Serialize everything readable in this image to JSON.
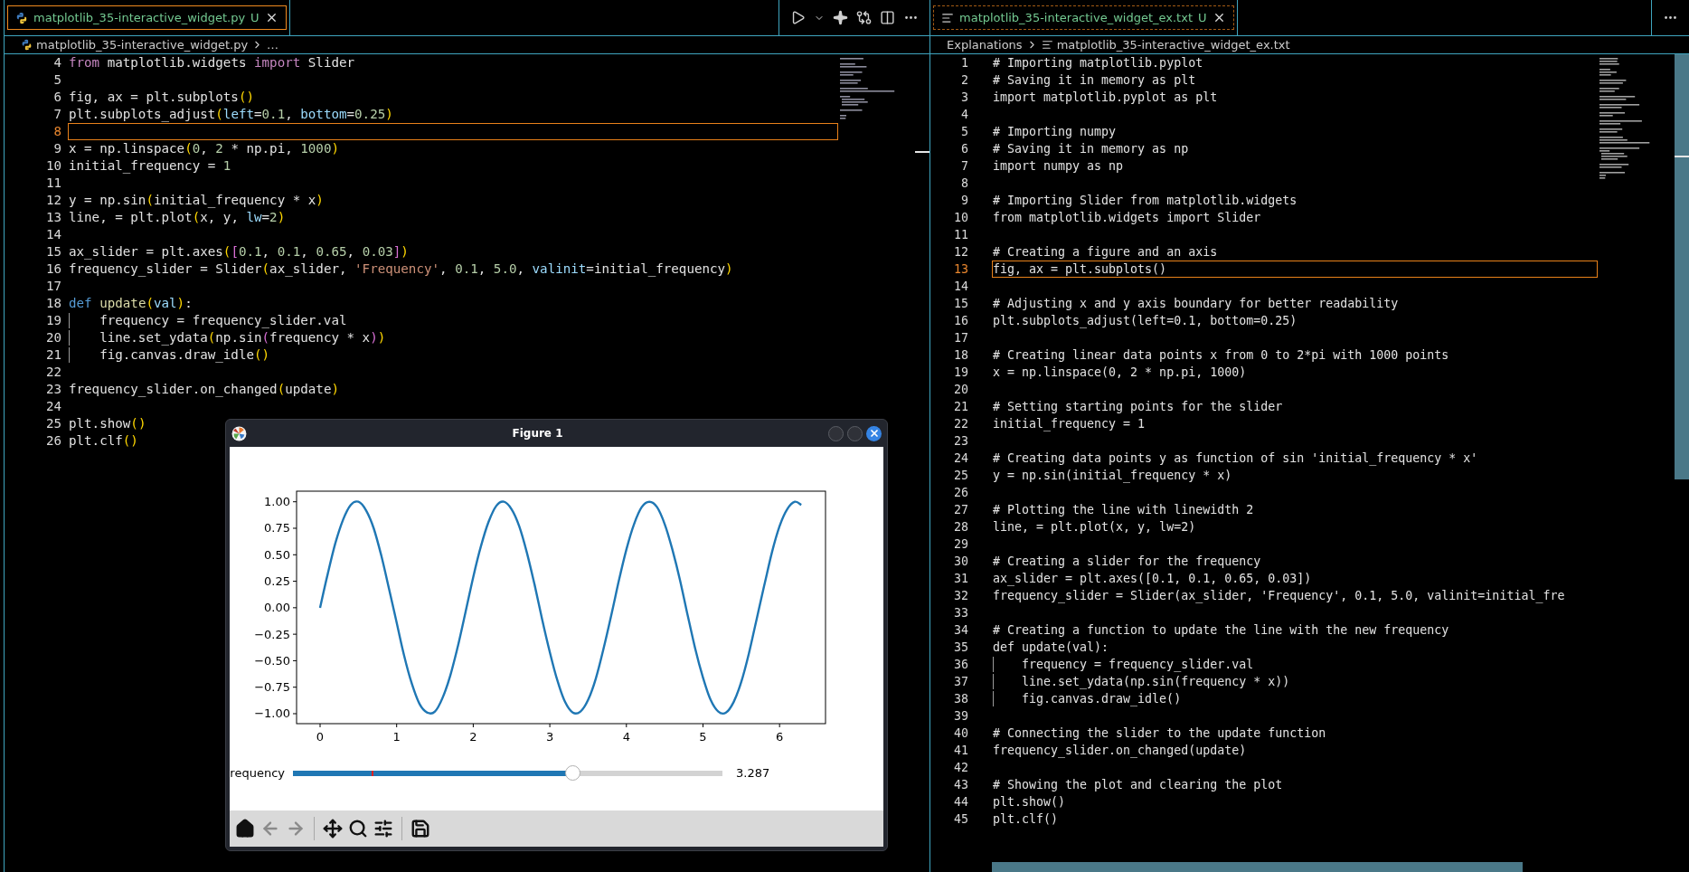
{
  "panes": [
    {
      "tab": {
        "kind": "python",
        "label": "matplotlib_35-interactive_widget.py",
        "status": "U",
        "focused": true
      },
      "actions": [
        {
          "kind": "run"
        },
        {
          "kind": "dropdown"
        },
        {
          "kind": "sparkle"
        },
        {
          "kind": "compare"
        },
        {
          "kind": "split"
        },
        {
          "kind": "more"
        }
      ],
      "breadcrumb": [
        {
          "kind": "python",
          "label": "matplotlib_35-interactive_widget.py"
        },
        {
          "kind": "plain",
          "label": "…"
        }
      ],
      "scrollable": false,
      "lines": [
        {
          "number": "4",
          "current": false,
          "tokens": [
            {
              "kind": "keyword",
              "text": "from"
            },
            {
              "kind": "text",
              "text": " matplotlib.widgets "
            },
            {
              "kind": "keyword",
              "text": "import"
            },
            {
              "kind": "text",
              "text": " Slider"
            }
          ]
        },
        {
          "number": "5",
          "current": false
        },
        {
          "number": "6",
          "current": false,
          "tokens": [
            {
              "kind": "text",
              "text": "fig, ax = plt.subplots"
            },
            {
              "kind": "bracket",
              "text": "()"
            }
          ]
        },
        {
          "number": "7",
          "current": false,
          "tokens": [
            {
              "kind": "text",
              "text": "plt.subplots_adjust"
            },
            {
              "kind": "bracket",
              "text": "("
            },
            {
              "kind": "param",
              "text": "left"
            },
            {
              "kind": "text",
              "text": "="
            },
            {
              "kind": "number",
              "text": "0.1"
            },
            {
              "kind": "text",
              "text": ", "
            },
            {
              "kind": "param",
              "text": "bottom"
            },
            {
              "kind": "text",
              "text": "="
            },
            {
              "kind": "number",
              "text": "0.25"
            },
            {
              "kind": "bracket",
              "text": ")"
            }
          ]
        },
        {
          "number": "8",
          "current": true
        },
        {
          "number": "9",
          "current": false,
          "tokens": [
            {
              "kind": "text",
              "text": "x = np.linspace"
            },
            {
              "kind": "bracket",
              "text": "("
            },
            {
              "kind": "number",
              "text": "0"
            },
            {
              "kind": "text",
              "text": ", "
            },
            {
              "kind": "number",
              "text": "2"
            },
            {
              "kind": "text",
              "text": " * np.pi, "
            },
            {
              "kind": "number",
              "text": "1000"
            },
            {
              "kind": "bracket",
              "text": ")"
            }
          ]
        },
        {
          "number": "10",
          "current": false,
          "tokens": [
            {
              "kind": "text",
              "text": "initial_frequency = "
            },
            {
              "kind": "number",
              "text": "1"
            }
          ]
        },
        {
          "number": "11",
          "current": false
        },
        {
          "number": "12",
          "current": false,
          "tokens": [
            {
              "kind": "text",
              "text": "y = np.sin"
            },
            {
              "kind": "bracket",
              "text": "("
            },
            {
              "kind": "text",
              "text": "initial_frequency * x"
            },
            {
              "kind": "bracket",
              "text": ")"
            }
          ]
        },
        {
          "number": "13",
          "current": false,
          "tokens": [
            {
              "kind": "text",
              "text": "line, = plt.plot"
            },
            {
              "kind": "bracket",
              "text": "("
            },
            {
              "kind": "text",
              "text": "x, y, "
            },
            {
              "kind": "param",
              "text": "lw"
            },
            {
              "kind": "text",
              "text": "="
            },
            {
              "kind": "number",
              "text": "2"
            },
            {
              "kind": "bracket",
              "text": ")"
            }
          ]
        },
        {
          "number": "14",
          "current": false
        },
        {
          "number": "15",
          "current": false,
          "tokens": [
            {
              "kind": "text",
              "text": "ax_slider = plt.axes"
            },
            {
              "kind": "bracket",
              "text": "("
            },
            {
              "kind": "bracket2",
              "text": "["
            },
            {
              "kind": "number",
              "text": "0.1"
            },
            {
              "kind": "text",
              "text": ", "
            },
            {
              "kind": "number",
              "text": "0.1"
            },
            {
              "kind": "text",
              "text": ", "
            },
            {
              "kind": "number",
              "text": "0.65"
            },
            {
              "kind": "text",
              "text": ", "
            },
            {
              "kind": "number",
              "text": "0.03"
            },
            {
              "kind": "bracket2",
              "text": "]"
            },
            {
              "kind": "bracket",
              "text": ")"
            }
          ]
        },
        {
          "number": "16",
          "current": false,
          "tokens": [
            {
              "kind": "text",
              "text": "frequency_slider = Slider"
            },
            {
              "kind": "bracket",
              "text": "("
            },
            {
              "kind": "text",
              "text": "ax_slider, "
            },
            {
              "kind": "string",
              "text": "'Frequency'"
            },
            {
              "kind": "text",
              "text": ", "
            },
            {
              "kind": "number",
              "text": "0.1"
            },
            {
              "kind": "text",
              "text": ", "
            },
            {
              "kind": "number",
              "text": "5.0"
            },
            {
              "kind": "text",
              "text": ", "
            },
            {
              "kind": "param",
              "text": "valinit"
            },
            {
              "kind": "text",
              "text": "=initial_frequency"
            },
            {
              "kind": "bracket",
              "text": ")"
            }
          ]
        },
        {
          "number": "17",
          "current": false
        },
        {
          "number": "18",
          "current": false,
          "tokens": [
            {
              "kind": "storage",
              "text": "def "
            },
            {
              "kind": "function",
              "text": "update"
            },
            {
              "kind": "bracket",
              "text": "("
            },
            {
              "kind": "param",
              "text": "val"
            },
            {
              "kind": "bracket",
              "text": ")"
            },
            {
              "kind": "text",
              "text": ":"
            }
          ]
        },
        {
          "number": "19",
          "current": false,
          "indent": true,
          "tokens": [
            {
              "kind": "text",
              "text": "frequency = frequency_slider.val"
            }
          ]
        },
        {
          "number": "20",
          "current": false,
          "indent": true,
          "tokens": [
            {
              "kind": "text",
              "text": "line.set_ydata"
            },
            {
              "kind": "bracket",
              "text": "("
            },
            {
              "kind": "text",
              "text": "np.sin"
            },
            {
              "kind": "bracket2",
              "text": "("
            },
            {
              "kind": "text",
              "text": "frequency * x"
            },
            {
              "kind": "bracket2",
              "text": ")"
            },
            {
              "kind": "bracket",
              "text": ")"
            }
          ]
        },
        {
          "number": "21",
          "current": false,
          "indent": true,
          "tokens": [
            {
              "kind": "text",
              "text": "fig.canvas.draw_idle"
            },
            {
              "kind": "bracket",
              "text": "()"
            }
          ]
        },
        {
          "number": "22",
          "current": false
        },
        {
          "number": "23",
          "current": false,
          "tokens": [
            {
              "kind": "text",
              "text": "frequency_slider.on_changed"
            },
            {
              "kind": "bracket",
              "text": "("
            },
            {
              "kind": "text",
              "text": "update"
            },
            {
              "kind": "bracket",
              "text": ")"
            }
          ]
        },
        {
          "number": "24",
          "current": false
        },
        {
          "number": "25",
          "current": false,
          "tokens": [
            {
              "kind": "text",
              "text": "plt.show"
            },
            {
              "kind": "bracket",
              "text": "()"
            }
          ]
        },
        {
          "number": "26",
          "current": false,
          "tokens": [
            {
              "kind": "text",
              "text": "plt.clf"
            },
            {
              "kind": "bracket",
              "text": "()"
            }
          ]
        }
      ]
    },
    {
      "tab": {
        "kind": "text",
        "label": "matplotlib_35-interactive_widget_ex.txt",
        "status": "U",
        "focused": false
      },
      "actions": [
        {
          "kind": "more"
        }
      ],
      "breadcrumb": [
        {
          "kind": "plain",
          "label": "Explanations"
        },
        {
          "kind": "text",
          "label": "matplotlib_35-interactive_widget_ex.txt"
        }
      ],
      "scrollable": true,
      "lines": [
        {
          "number": "1",
          "current": false,
          "tokens": [
            {
              "kind": "text",
              "text": "# Importing matplotlib.pyplot"
            }
          ]
        },
        {
          "number": "2",
          "current": false,
          "tokens": [
            {
              "kind": "text",
              "text": "# Saving it in memory as plt"
            }
          ]
        },
        {
          "number": "3",
          "current": false,
          "tokens": [
            {
              "kind": "text",
              "text": "import matplotlib.pyplot as plt"
            }
          ]
        },
        {
          "number": "4",
          "current": false
        },
        {
          "number": "5",
          "current": false,
          "tokens": [
            {
              "kind": "text",
              "text": "# Importing numpy"
            }
          ]
        },
        {
          "number": "6",
          "current": false,
          "tokens": [
            {
              "kind": "text",
              "text": "# Saving it in memory as np"
            }
          ]
        },
        {
          "number": "7",
          "current": false,
          "tokens": [
            {
              "kind": "text",
              "text": "import numpy as np"
            }
          ]
        },
        {
          "number": "8",
          "current": false
        },
        {
          "number": "9",
          "current": false,
          "tokens": [
            {
              "kind": "text",
              "text": "# Importing Slider from matplotlib.widgets"
            }
          ]
        },
        {
          "number": "10",
          "current": false,
          "tokens": [
            {
              "kind": "text",
              "text": "from matplotlib.widgets import Slider"
            }
          ]
        },
        {
          "number": "11",
          "current": false
        },
        {
          "number": "12",
          "current": false,
          "tokens": [
            {
              "kind": "text",
              "text": "# Creating a figure and an axis"
            }
          ]
        },
        {
          "number": "13",
          "current": true,
          "tokens": [
            {
              "kind": "text",
              "text": "fig, ax = plt.subplots()"
            }
          ]
        },
        {
          "number": "14",
          "current": false
        },
        {
          "number": "15",
          "current": false,
          "tokens": [
            {
              "kind": "text",
              "text": "# Adjusting x and y axis boundary for better readability"
            }
          ]
        },
        {
          "number": "16",
          "current": false,
          "tokens": [
            {
              "kind": "text",
              "text": "plt.subplots_adjust(left=0.1, bottom=0.25)"
            }
          ]
        },
        {
          "number": "17",
          "current": false
        },
        {
          "number": "18",
          "current": false,
          "tokens": [
            {
              "kind": "text",
              "text": "# Creating linear data points x from 0 to 2*pi with 1000 points"
            }
          ]
        },
        {
          "number": "19",
          "current": false,
          "tokens": [
            {
              "kind": "text",
              "text": "x = np.linspace(0, 2 * np.pi, 1000)"
            }
          ]
        },
        {
          "number": "20",
          "current": false
        },
        {
          "number": "21",
          "current": false,
          "tokens": [
            {
              "kind": "text",
              "text": "# Setting starting points for the slider"
            }
          ]
        },
        {
          "number": "22",
          "current": false,
          "tokens": [
            {
              "kind": "text",
              "text": "initial_frequency = 1"
            }
          ]
        },
        {
          "number": "23",
          "current": false
        },
        {
          "number": "24",
          "current": false,
          "tokens": [
            {
              "kind": "text",
              "text": "# Creating data points y as function of sin 'initial_frequency * x'"
            }
          ]
        },
        {
          "number": "25",
          "current": false,
          "tokens": [
            {
              "kind": "text",
              "text": "y = np.sin(initial_frequency * x)"
            }
          ]
        },
        {
          "number": "26",
          "current": false
        },
        {
          "number": "27",
          "current": false,
          "tokens": [
            {
              "kind": "text",
              "text": "# Plotting the line with linewidth 2"
            }
          ]
        },
        {
          "number": "28",
          "current": false,
          "tokens": [
            {
              "kind": "text",
              "text": "line, = plt.plot(x, y, lw=2)"
            }
          ]
        },
        {
          "number": "29",
          "current": false
        },
        {
          "number": "30",
          "current": false,
          "tokens": [
            {
              "kind": "text",
              "text": "# Creating a slider for the frequency"
            }
          ]
        },
        {
          "number": "31",
          "current": false,
          "tokens": [
            {
              "kind": "text",
              "text": "ax_slider = plt.axes([0.1, 0.1, 0.65, 0.03])"
            }
          ]
        },
        {
          "number": "32",
          "current": false,
          "tokens": [
            {
              "kind": "text",
              "text": "frequency_slider = Slider(ax_slider, 'Frequency', 0.1, 5.0, valinit=initial_fre"
            }
          ]
        },
        {
          "number": "33",
          "current": false
        },
        {
          "number": "34",
          "current": false,
          "tokens": [
            {
              "kind": "text",
              "text": "# Creating a function to update the line with the new frequency"
            }
          ]
        },
        {
          "number": "35",
          "current": false,
          "tokens": [
            {
              "kind": "text",
              "text": "def update(val):"
            }
          ]
        },
        {
          "number": "36",
          "current": false,
          "indent": true,
          "tokens": [
            {
              "kind": "text",
              "text": "frequency = frequency_slider.val"
            }
          ]
        },
        {
          "number": "37",
          "current": false,
          "indent": true,
          "tokens": [
            {
              "kind": "text",
              "text": "line.set_ydata(np.sin(frequency * x))"
            }
          ]
        },
        {
          "number": "38",
          "current": false,
          "indent": true,
          "tokens": [
            {
              "kind": "text",
              "text": "fig.canvas.draw_idle()"
            }
          ]
        },
        {
          "number": "39",
          "current": false
        },
        {
          "number": "40",
          "current": false,
          "tokens": [
            {
              "kind": "text",
              "text": "# Connecting the slider to the update function"
            }
          ]
        },
        {
          "number": "41",
          "current": false,
          "tokens": [
            {
              "kind": "text",
              "text": "frequency_slider.on_changed(update)"
            }
          ]
        },
        {
          "number": "42",
          "current": false
        },
        {
          "number": "43",
          "current": false,
          "tokens": [
            {
              "kind": "text",
              "text": "# Showing the plot and clearing the plot"
            }
          ]
        },
        {
          "number": "44",
          "current": false,
          "tokens": [
            {
              "kind": "text",
              "text": "plt.show()"
            }
          ]
        },
        {
          "number": "45",
          "current": false,
          "tokens": [
            {
              "kind": "text",
              "text": "plt.clf()"
            }
          ]
        }
      ]
    }
  ],
  "figure": {
    "title": "Figure 1",
    "controls": [
      {
        "kind": "minimize"
      },
      {
        "kind": "maximize"
      },
      {
        "kind": "close"
      }
    ],
    "chart_data": {
      "type": "line",
      "x": [
        0,
        0.1,
        0.2,
        0.3,
        0.4,
        0.5,
        0.6,
        0.7,
        0.8,
        0.9,
        1.0,
        1.1,
        1.2,
        1.3,
        1.4,
        1.5,
        1.6,
        1.7,
        1.8,
        1.9,
        2.0,
        2.1,
        2.2,
        2.3,
        2.4,
        2.5,
        2.6,
        2.7,
        2.8,
        2.9,
        3.0,
        3.1,
        3.2,
        3.3,
        3.4,
        3.5,
        3.6,
        3.7,
        3.8,
        3.9,
        4.0,
        4.1,
        4.2,
        4.3,
        4.4,
        4.5,
        4.6,
        4.7,
        4.8,
        4.9,
        5.0,
        5.1,
        5.2,
        5.3,
        5.4,
        5.5,
        5.6,
        5.7,
        5.8,
        5.9,
        6.0,
        6.1,
        6.2,
        6.283
      ],
      "series": [
        {
          "color": "#1f77b4",
          "values": [
            0,
            0.32,
            0.61,
            0.83,
            0.97,
            1.0,
            0.92,
            0.75,
            0.49,
            0.18,
            -0.14,
            -0.46,
            -0.72,
            -0.91,
            -0.99,
            -0.98,
            -0.85,
            -0.64,
            -0.36,
            -0.04,
            0.29,
            0.58,
            0.81,
            0.96,
            1.0,
            0.93,
            0.77,
            0.52,
            0.22,
            -0.11,
            -0.42,
            -0.69,
            -0.89,
            -0.99,
            -0.98,
            -0.87,
            -0.67,
            -0.39,
            -0.08,
            0.25,
            0.55,
            0.79,
            0.95,
            1.0,
            0.95,
            0.79,
            0.55,
            0.26,
            -0.07,
            -0.39,
            -0.66,
            -0.87,
            -0.98,
            -0.99,
            -0.89,
            -0.7,
            -0.43,
            -0.11,
            0.21,
            0.52,
            0.77,
            0.93,
            1.0,
            0.97
          ]
        }
      ],
      "xlim": [
        -0.307,
        6.6
      ],
      "ylim": [
        -1.094,
        1.1
      ],
      "xticks": [
        0,
        1,
        2,
        3,
        4,
        5,
        6
      ],
      "yticks": [
        {
          "value": 1,
          "label": "1.00"
        },
        {
          "value": 0.75,
          "label": "0.75"
        },
        {
          "value": 0.5,
          "label": "0.50"
        },
        {
          "value": 0.25,
          "label": "0.25"
        },
        {
          "value": 0,
          "label": "0.00"
        },
        {
          "value": -0.25,
          "label": "−0.25"
        },
        {
          "value": -0.5,
          "label": "−0.50"
        },
        {
          "value": -0.75,
          "label": "−0.75"
        },
        {
          "value": -1,
          "label": "−1.00"
        }
      ]
    },
    "slider": {
      "label": "requency",
      "level": 0.65,
      "reading": "3.287"
    },
    "tools": [
      {
        "kind": "home",
        "disabled": false
      },
      {
        "kind": "back",
        "disabled": true
      },
      {
        "kind": "forward",
        "disabled": true
      },
      {
        "kind": "separator"
      },
      {
        "kind": "move",
        "disabled": false
      },
      {
        "kind": "zoom",
        "disabled": false
      },
      {
        "kind": "configure",
        "disabled": false
      },
      {
        "kind": "separator"
      },
      {
        "kind": "save",
        "disabled": false
      }
    ]
  }
}
